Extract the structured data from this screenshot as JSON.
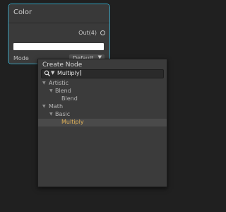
{
  "node": {
    "title": "Color",
    "output_label": "Out(4)",
    "color_value": "#ffffff",
    "mode_label": "Mode",
    "mode_value": "Default"
  },
  "create_node": {
    "title": "Create Node",
    "search_value": "Multiply",
    "tree": [
      {
        "label": "Artistic",
        "expanded": true
      },
      {
        "label": "Blend",
        "expanded": true
      },
      {
        "label": "Blend"
      },
      {
        "label": "Math",
        "expanded": true
      },
      {
        "label": "Basic",
        "expanded": true
      },
      {
        "label": "Multiply",
        "selected": true
      }
    ]
  },
  "colors": {
    "node_border": "#39a3bf",
    "selected_text": "#e3b35a"
  }
}
